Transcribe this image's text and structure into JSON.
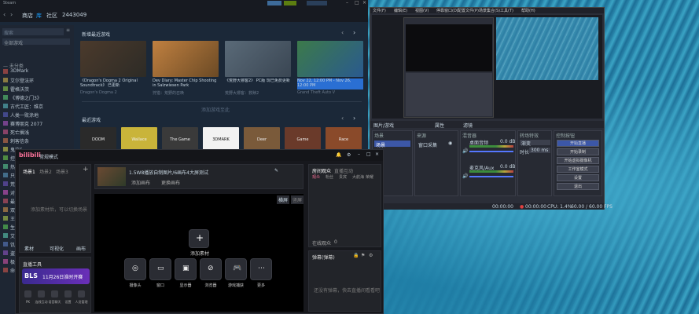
{
  "colors": {
    "steam_bg": "#1b2838",
    "steam_top": "#171a21",
    "bili_bg": "#17181d",
    "bili_accent": "#fb7299",
    "obs_active_btn": "#3c57a7",
    "sale_blue": "#2a6fd3"
  },
  "steam": {
    "titlebar": "Steam",
    "nav": [
      "商店",
      "库",
      "社区",
      "2443049"
    ],
    "search_placeholder": "搜索",
    "filter_label": "全部游戏",
    "section_label": "— 未分类",
    "library_items": [
      "3DMark",
      "艾尔登法环",
      "霍格沃茨",
      "《博德之门3》",
      "古代工匠：维京",
      "人类一败涂地",
      "赛博朋克 2077",
      "死亡搁浅",
      "刺客信条",
      "鬼泣5",
      "控制",
      "热血无赖",
      "只狼",
      "荒野大镖客2",
      "对马岛",
      "最终幻想14",
      "双人成行",
      "王国之泪",
      "生化危机4",
      "艾尔登法环",
      "饥荒",
      "盗贼之海",
      "极限竞速",
      "命运2"
    ],
    "shelf1_title": "新增最近游戏",
    "shelf1": [
      {
        "caption": "《Dragon's Dogma 2 Original Soundtrack》 已更新",
        "sub": "Dragon's Dogma 2"
      },
      {
        "caption": "Dev Diary: Master Chip Shooting in Salzwiesen Park",
        "sub": "狩猎：荒野的召唤"
      },
      {
        "caption": "《荒野大镖客2》 PC版 现已免费更新",
        "sub": "荒野大镖客：救赎2"
      },
      {
        "caption": "Nov 22, 12:00 PM - Nov 26, 12:00 PM",
        "sub": "Grand Theft Auto V"
      }
    ],
    "shelf1_divider": "添加游戏至此",
    "shelf2_title": "最近游戏",
    "shelf2_games": [
      "DOOM",
      "Wallace",
      "The Game",
      "3DMARK",
      "Deer",
      "Game",
      "Race"
    ]
  },
  "obs": {
    "menu": [
      "文件(F)",
      "编辑(E)",
      "视图(V)",
      "停靠窗口(D)",
      "配置文件(P)",
      "场景集合(S)",
      "工具(T)",
      "帮助(H)"
    ],
    "preview_label": "图片/游戏",
    "ctrl_props": "属性",
    "ctrl_filters": "滤镜",
    "panels": {
      "scenes": "场景",
      "sources": "来源",
      "mixer": "混音器",
      "transitions": "转场特效",
      "controls": "控制按钮"
    },
    "scene_item": "场景",
    "source_item": "窗口采集",
    "mixer_tracks": [
      {
        "name": "桌面音频",
        "db": "0.0 dB"
      },
      {
        "name": "麦克风/Aux",
        "db": "0.0 dB"
      }
    ],
    "transition_type": "渐变",
    "transition_duration_label": "时长",
    "transition_duration": "300 ms",
    "buttons": [
      "开始直播",
      "开始录制",
      "开始虚拟摄像机",
      "工作室模式",
      "设置",
      "退出"
    ],
    "status": {
      "live": "00:00:00",
      "rec": "00:00:00",
      "cpu": "CPU: 1.4%",
      "fps": "60.00 / 60.00 FPS"
    }
  },
  "bili": {
    "logo": "bilibili",
    "mode": "常规模式",
    "tabs": [
      "场景1",
      "场景2",
      "场景3"
    ],
    "empty_hint": "添加素材后，可以切换场景",
    "footer_btns": [
      "素材",
      "可视化",
      "画布"
    ],
    "source_title": "1.5W8播放自制图片/6画布4大屏测试",
    "source_actions": [
      "添加画布",
      "更换画布"
    ],
    "preview_badges": [
      "横屏",
      "竖屏"
    ],
    "add_btn": "添加素材",
    "tools": [
      "摄像头",
      "窗口",
      "显示器",
      "浏览器",
      "游戏捕获",
      "更多"
    ],
    "live_tools": "直播工具",
    "banner_brand": "BLS",
    "banner_text": "11月26日淮时开赛",
    "bottom_icons": [
      "PK",
      "连线互动",
      "语音聊天",
      "设置",
      "人员管理"
    ],
    "right_tabs": [
      "房间观众",
      "直播互动"
    ],
    "right_subtabs": [
      "观众",
      "粉丝",
      "贵宾",
      "大航海",
      "荣耀"
    ],
    "online_label": "在线观众",
    "online_count": "0",
    "danmaku_title": "弹幕(弹幕)",
    "danmaku_hint": "还没有弹幕，快去直播间看看吧"
  }
}
